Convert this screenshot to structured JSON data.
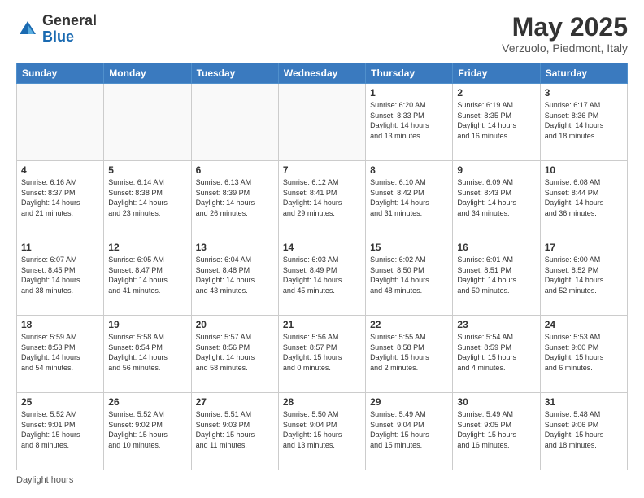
{
  "header": {
    "logo_general": "General",
    "logo_blue": "Blue",
    "month_title": "May 2025",
    "location": "Verzuolo, Piedmont, Italy"
  },
  "days_of_week": [
    "Sunday",
    "Monday",
    "Tuesday",
    "Wednesday",
    "Thursday",
    "Friday",
    "Saturday"
  ],
  "weeks": [
    [
      {
        "day": "",
        "info": ""
      },
      {
        "day": "",
        "info": ""
      },
      {
        "day": "",
        "info": ""
      },
      {
        "day": "",
        "info": ""
      },
      {
        "day": "1",
        "info": "Sunrise: 6:20 AM\nSunset: 8:33 PM\nDaylight: 14 hours\nand 13 minutes."
      },
      {
        "day": "2",
        "info": "Sunrise: 6:19 AM\nSunset: 8:35 PM\nDaylight: 14 hours\nand 16 minutes."
      },
      {
        "day": "3",
        "info": "Sunrise: 6:17 AM\nSunset: 8:36 PM\nDaylight: 14 hours\nand 18 minutes."
      }
    ],
    [
      {
        "day": "4",
        "info": "Sunrise: 6:16 AM\nSunset: 8:37 PM\nDaylight: 14 hours\nand 21 minutes."
      },
      {
        "day": "5",
        "info": "Sunrise: 6:14 AM\nSunset: 8:38 PM\nDaylight: 14 hours\nand 23 minutes."
      },
      {
        "day": "6",
        "info": "Sunrise: 6:13 AM\nSunset: 8:39 PM\nDaylight: 14 hours\nand 26 minutes."
      },
      {
        "day": "7",
        "info": "Sunrise: 6:12 AM\nSunset: 8:41 PM\nDaylight: 14 hours\nand 29 minutes."
      },
      {
        "day": "8",
        "info": "Sunrise: 6:10 AM\nSunset: 8:42 PM\nDaylight: 14 hours\nand 31 minutes."
      },
      {
        "day": "9",
        "info": "Sunrise: 6:09 AM\nSunset: 8:43 PM\nDaylight: 14 hours\nand 34 minutes."
      },
      {
        "day": "10",
        "info": "Sunrise: 6:08 AM\nSunset: 8:44 PM\nDaylight: 14 hours\nand 36 minutes."
      }
    ],
    [
      {
        "day": "11",
        "info": "Sunrise: 6:07 AM\nSunset: 8:45 PM\nDaylight: 14 hours\nand 38 minutes."
      },
      {
        "day": "12",
        "info": "Sunrise: 6:05 AM\nSunset: 8:47 PM\nDaylight: 14 hours\nand 41 minutes."
      },
      {
        "day": "13",
        "info": "Sunrise: 6:04 AM\nSunset: 8:48 PM\nDaylight: 14 hours\nand 43 minutes."
      },
      {
        "day": "14",
        "info": "Sunrise: 6:03 AM\nSunset: 8:49 PM\nDaylight: 14 hours\nand 45 minutes."
      },
      {
        "day": "15",
        "info": "Sunrise: 6:02 AM\nSunset: 8:50 PM\nDaylight: 14 hours\nand 48 minutes."
      },
      {
        "day": "16",
        "info": "Sunrise: 6:01 AM\nSunset: 8:51 PM\nDaylight: 14 hours\nand 50 minutes."
      },
      {
        "day": "17",
        "info": "Sunrise: 6:00 AM\nSunset: 8:52 PM\nDaylight: 14 hours\nand 52 minutes."
      }
    ],
    [
      {
        "day": "18",
        "info": "Sunrise: 5:59 AM\nSunset: 8:53 PM\nDaylight: 14 hours\nand 54 minutes."
      },
      {
        "day": "19",
        "info": "Sunrise: 5:58 AM\nSunset: 8:54 PM\nDaylight: 14 hours\nand 56 minutes."
      },
      {
        "day": "20",
        "info": "Sunrise: 5:57 AM\nSunset: 8:56 PM\nDaylight: 14 hours\nand 58 minutes."
      },
      {
        "day": "21",
        "info": "Sunrise: 5:56 AM\nSunset: 8:57 PM\nDaylight: 15 hours\nand 0 minutes."
      },
      {
        "day": "22",
        "info": "Sunrise: 5:55 AM\nSunset: 8:58 PM\nDaylight: 15 hours\nand 2 minutes."
      },
      {
        "day": "23",
        "info": "Sunrise: 5:54 AM\nSunset: 8:59 PM\nDaylight: 15 hours\nand 4 minutes."
      },
      {
        "day": "24",
        "info": "Sunrise: 5:53 AM\nSunset: 9:00 PM\nDaylight: 15 hours\nand 6 minutes."
      }
    ],
    [
      {
        "day": "25",
        "info": "Sunrise: 5:52 AM\nSunset: 9:01 PM\nDaylight: 15 hours\nand 8 minutes."
      },
      {
        "day": "26",
        "info": "Sunrise: 5:52 AM\nSunset: 9:02 PM\nDaylight: 15 hours\nand 10 minutes."
      },
      {
        "day": "27",
        "info": "Sunrise: 5:51 AM\nSunset: 9:03 PM\nDaylight: 15 hours\nand 11 minutes."
      },
      {
        "day": "28",
        "info": "Sunrise: 5:50 AM\nSunset: 9:04 PM\nDaylight: 15 hours\nand 13 minutes."
      },
      {
        "day": "29",
        "info": "Sunrise: 5:49 AM\nSunset: 9:04 PM\nDaylight: 15 hours\nand 15 minutes."
      },
      {
        "day": "30",
        "info": "Sunrise: 5:49 AM\nSunset: 9:05 PM\nDaylight: 15 hours\nand 16 minutes."
      },
      {
        "day": "31",
        "info": "Sunrise: 5:48 AM\nSunset: 9:06 PM\nDaylight: 15 hours\nand 18 minutes."
      }
    ]
  ],
  "footer": {
    "daylight_hours": "Daylight hours"
  }
}
